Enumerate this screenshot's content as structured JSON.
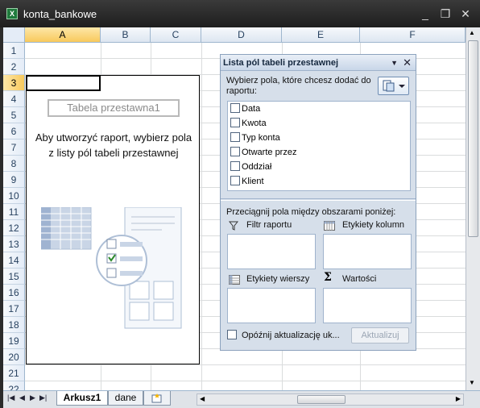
{
  "window": {
    "title": "konta_bankowe",
    "icon": "excel-icon",
    "controls": [
      "_",
      "❐",
      "✕"
    ]
  },
  "columns": [
    "A",
    "B",
    "C",
    "D",
    "E",
    "F"
  ],
  "rows": [
    "1",
    "2",
    "3",
    "4",
    "5",
    "6",
    "7",
    "8",
    "9",
    "10",
    "11",
    "12",
    "13",
    "14",
    "15",
    "16",
    "17",
    "18",
    "19",
    "20",
    "21",
    "22"
  ],
  "active_cell": {
    "column": "A",
    "row": "3"
  },
  "pivot_placeholder": {
    "name": "Tabela przestawna1",
    "message": "Aby utworzyć raport, wybierz pola z listy pól tabeli przestawnej"
  },
  "field_list": {
    "title": "Lista pól tabeli przestawnej",
    "instruction": "Wybierz pola, które chcesz dodać do raportu:",
    "fields": [
      "Data",
      "Kwota",
      "Typ konta",
      "Otwarte przez",
      "Oddział",
      "Klient"
    ],
    "drag_instruction": "Przeciągnij pola między obszarami poniżej:",
    "areas": {
      "filter": "Filtr raportu",
      "columns": "Etykiety kolumn",
      "rows": "Etykiety wierszy",
      "values": "Wartości"
    },
    "defer_label": "Opóźnij aktualizację uk...",
    "update_button": "Aktualizuj"
  },
  "sheets": [
    "Arkusz1",
    "dane"
  ],
  "active_sheet": "Arkusz1"
}
